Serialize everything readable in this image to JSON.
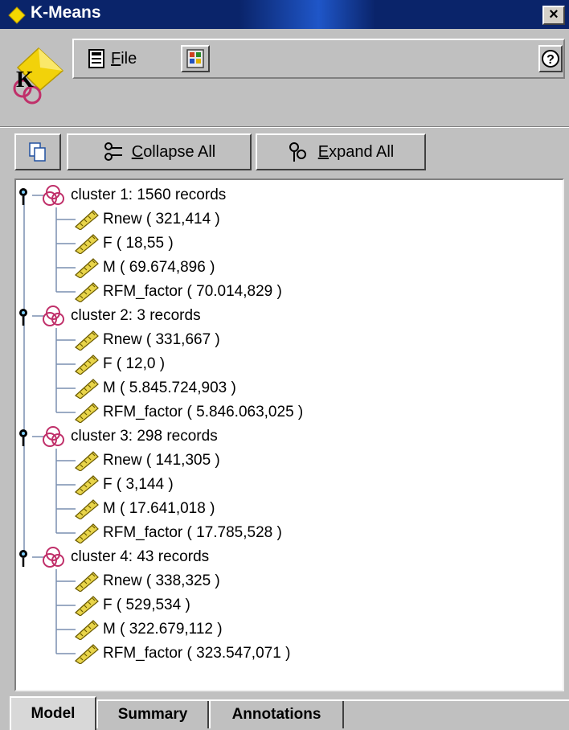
{
  "window": {
    "title": "K-Means",
    "close_label": "×"
  },
  "menu": {
    "file_accel": "F",
    "file_rest": "ile",
    "help_label": "?"
  },
  "buttons": {
    "collapse_accel": "C",
    "collapse_rest": "ollapse All",
    "expand_accel": "E",
    "expand_rest": "xpand All"
  },
  "tree": {
    "clusters": [
      {
        "label": "cluster 1: 1560 records",
        "fields": [
          "Rnew ( 321,414 )",
          "F ( 18,55 )",
          "M ( 69.674,896 )",
          "RFM_factor ( 70.014,829 )"
        ]
      },
      {
        "label": "cluster 2: 3 records",
        "fields": [
          "Rnew ( 331,667 )",
          "F ( 12,0 )",
          "M ( 5.845.724,903 )",
          "RFM_factor ( 5.846.063,025 )"
        ]
      },
      {
        "label": "cluster 3: 298 records",
        "fields": [
          "Rnew ( 141,305 )",
          "F ( 3,144 )",
          "M ( 17.641,018 )",
          "RFM_factor ( 17.785,528 )"
        ]
      },
      {
        "label": "cluster 4: 43 records",
        "fields": [
          "Rnew ( 338,325 )",
          "F ( 529,534 )",
          "M ( 322.679,112 )",
          "RFM_factor ( 323.547,071 )"
        ]
      }
    ]
  },
  "tabs": [
    {
      "label": "Model",
      "active": true
    },
    {
      "label": "Summary",
      "active": false
    },
    {
      "label": "Annotations",
      "active": false
    }
  ],
  "colors": {
    "title_bar": "#0a246a",
    "cluster_icon": "#c0306a",
    "ruler_icon": "#e8d44a"
  }
}
